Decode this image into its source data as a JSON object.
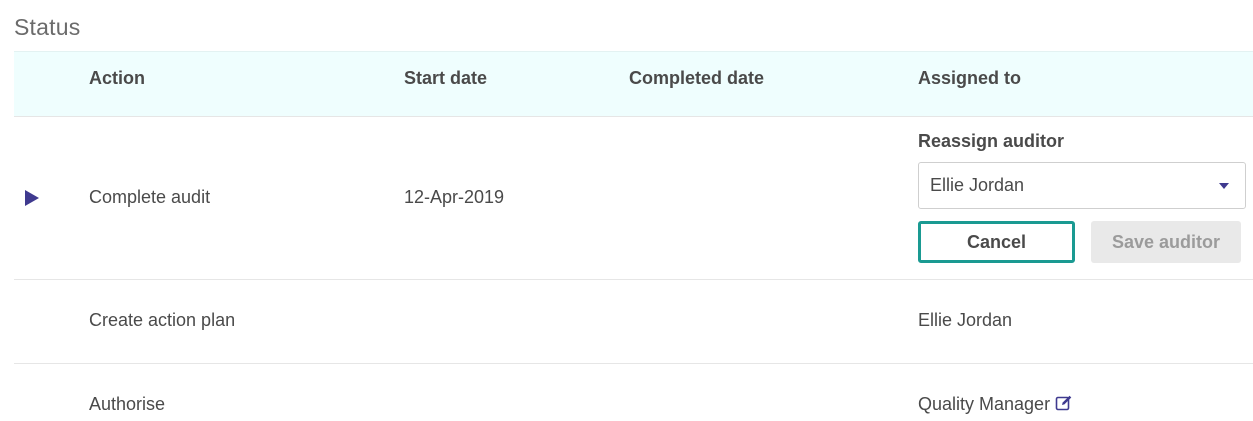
{
  "section": {
    "title": "Status"
  },
  "table": {
    "headers": {
      "action": "Action",
      "start_date": "Start date",
      "completed_date": "Completed date",
      "assigned_to": "Assigned to"
    },
    "rows": [
      {
        "action": "Complete audit",
        "start_date": "12-Apr-2019",
        "completed_date": "",
        "reassign": {
          "label": "Reassign auditor",
          "selected": "Ellie Jordan",
          "cancel_label": "Cancel",
          "save_label": "Save auditor",
          "save_enabled": false
        }
      },
      {
        "action": "Create action plan",
        "start_date": "",
        "completed_date": "",
        "assigned_to": "Ellie Jordan"
      },
      {
        "action": "Authorise",
        "start_date": "",
        "completed_date": "",
        "assigned_to": "Quality Manager",
        "assigned_icon": "edit-icon"
      }
    ]
  },
  "colors": {
    "header_bg": "#effefe",
    "accent": "#3f3a8f",
    "teal_button_border": "#1a9a92",
    "disabled_button_bg": "#e9e9e9"
  }
}
